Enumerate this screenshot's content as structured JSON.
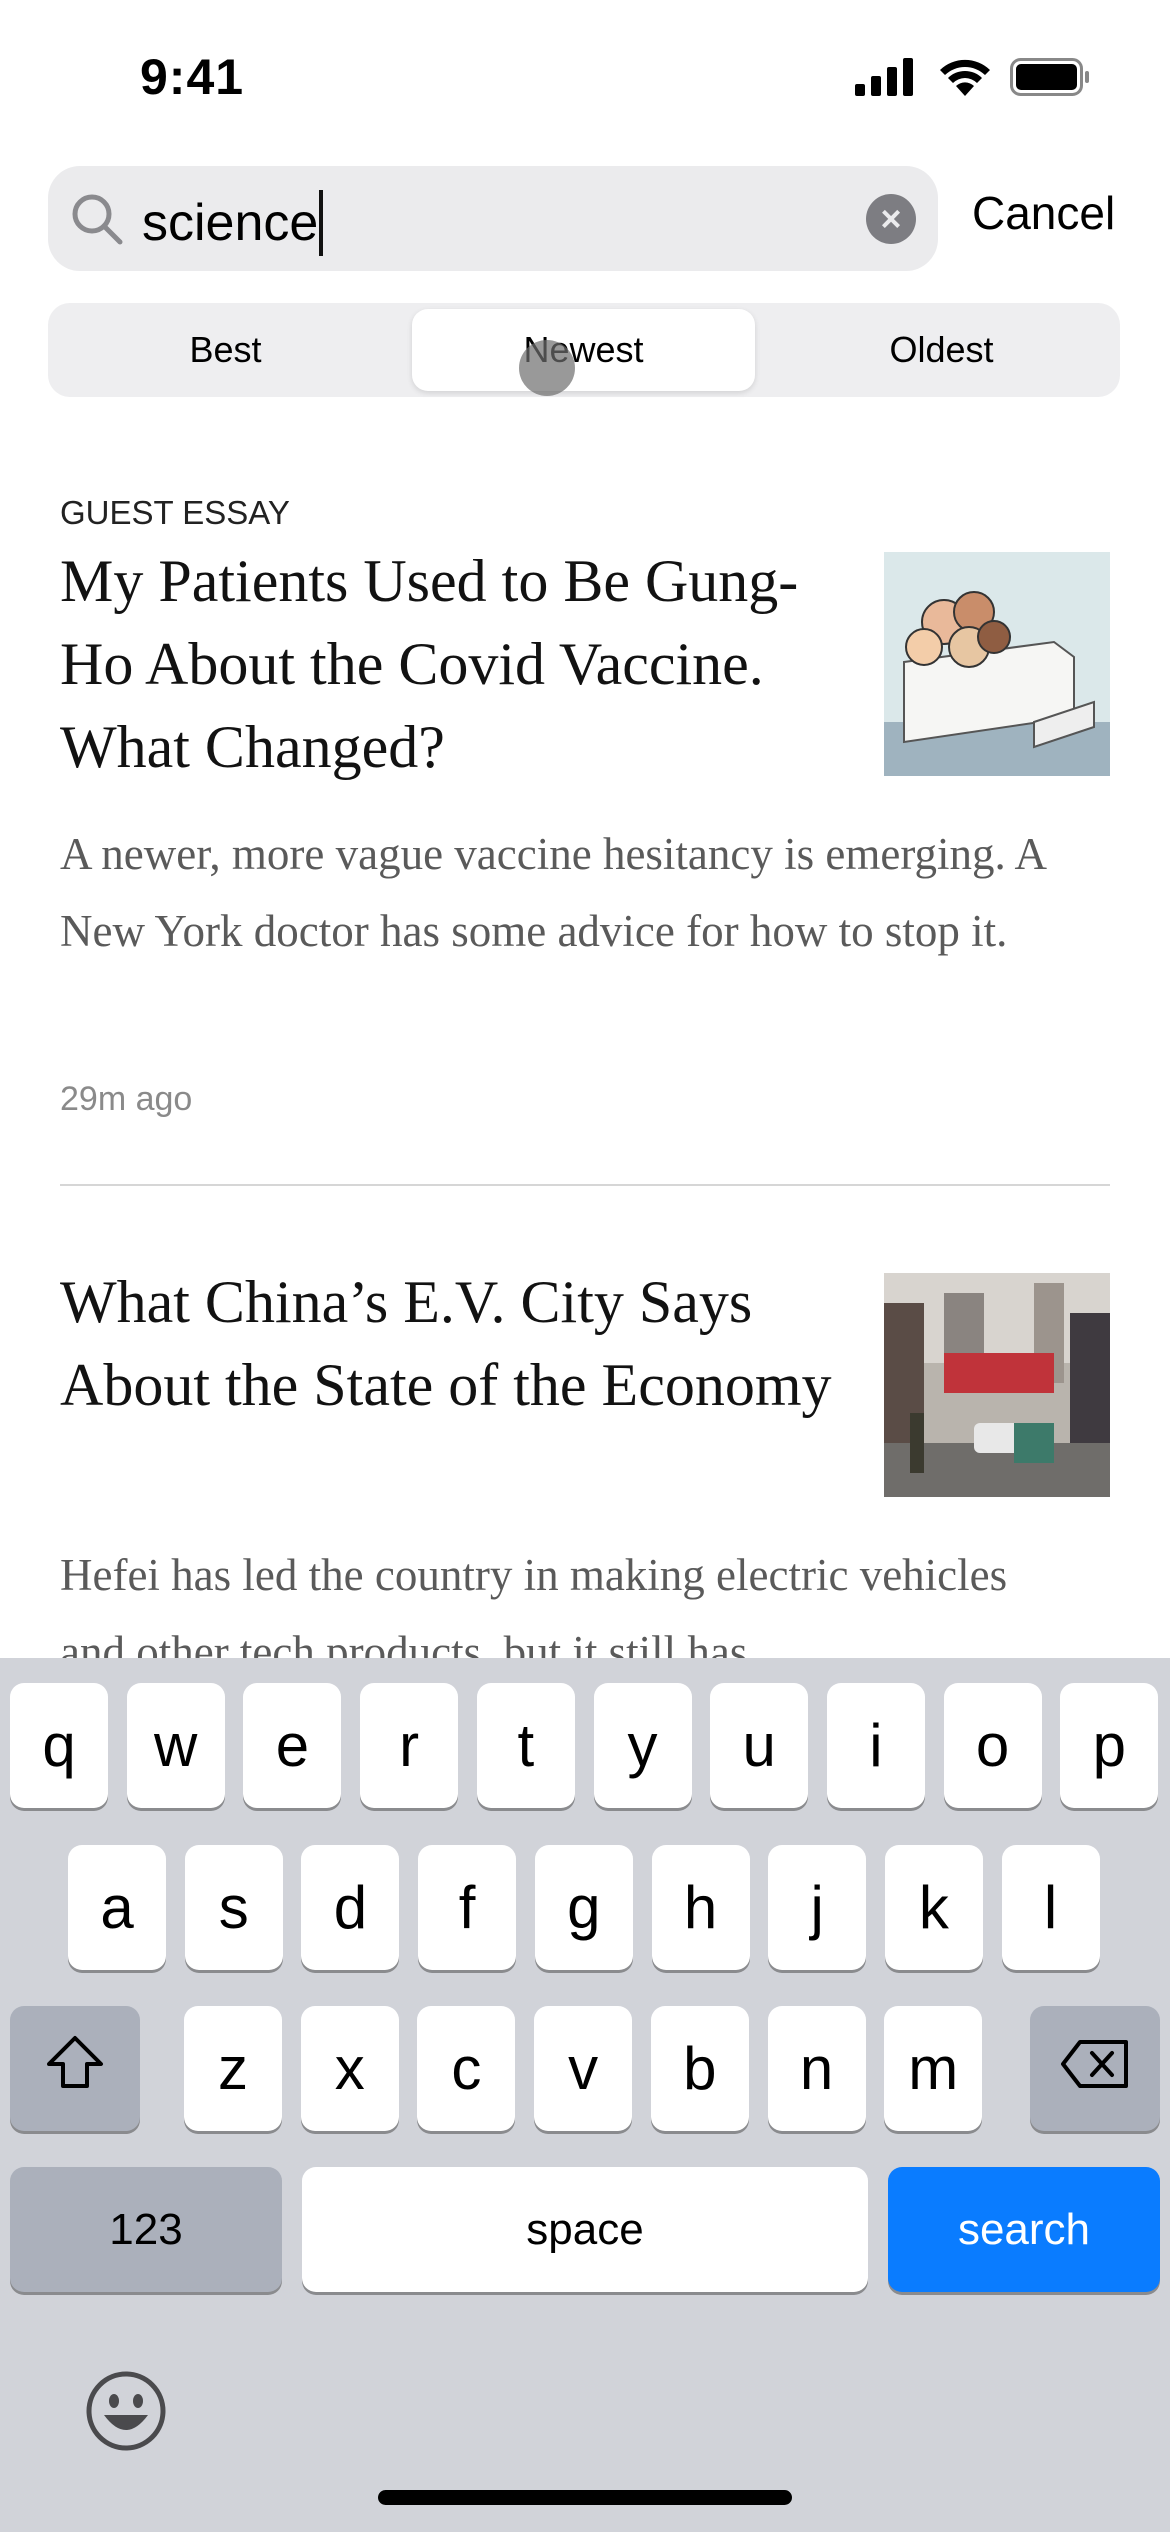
{
  "status_bar": {
    "time": "9:41",
    "icons": [
      "cellular-signal-icon",
      "wifi-icon",
      "battery-icon"
    ]
  },
  "search": {
    "value": "science",
    "cancel_label": "Cancel"
  },
  "sort_tabs": [
    {
      "label": "Best",
      "selected": false
    },
    {
      "label": "Newest",
      "selected": true
    },
    {
      "label": "Oldest",
      "selected": false
    }
  ],
  "articles": [
    {
      "kicker": "GUEST ESSAY",
      "headline": "My Patients Used to Be Gung-Ho About the Covid Vaccine. What Changed?",
      "summary": "A newer, more vague vaccine hesitancy is emerging. A New York doctor has some advice for how to stop it.",
      "timestamp": "29m ago"
    },
    {
      "kicker": "",
      "headline": "What China’s E.V. City Says About the State of the Economy",
      "summary": "Hefei has led the country in making electric vehicles and other tech products, but it still has"
    }
  ],
  "keyboard": {
    "row1": [
      "q",
      "w",
      "e",
      "r",
      "t",
      "y",
      "u",
      "i",
      "o",
      "p"
    ],
    "row2": [
      "a",
      "s",
      "d",
      "f",
      "g",
      "h",
      "j",
      "k",
      "l"
    ],
    "row3": [
      "z",
      "x",
      "c",
      "v",
      "b",
      "n",
      "m"
    ],
    "numbers_label": "123",
    "space_label": "space",
    "search_label": "search",
    "accent_color": "#0a7cff"
  }
}
